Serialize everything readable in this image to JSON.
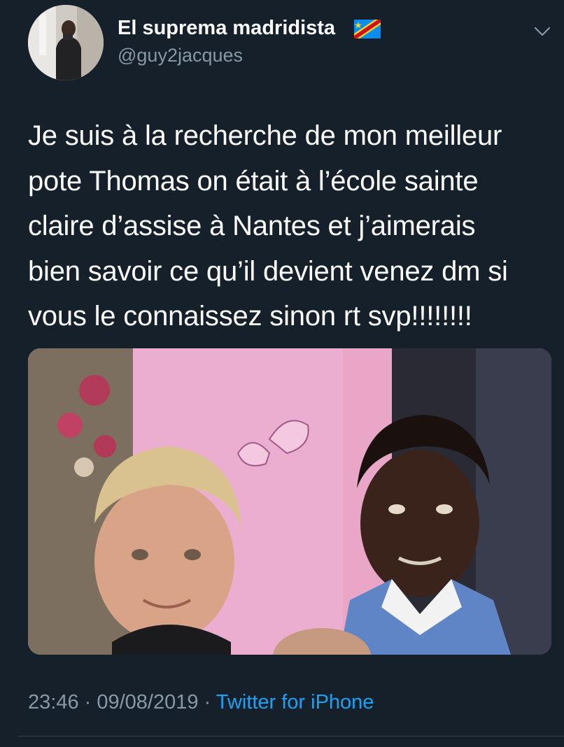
{
  "user": {
    "display_name": "El suprema madridista",
    "flag_icon": "flag-icon",
    "handle": "@guy2jacques"
  },
  "tweet": {
    "text": "Je suis à la recherche de mon meilleur\npote Thomas on était à l’école sainte\nclaire d’assise à Nantes et j’aimerais\nbien savoir ce qu’il devient venez dm si\nvous le connaissez sinon rt svp!!!!!!!!",
    "time": "23:46",
    "separator": " · ",
    "date": "09/08/2019",
    "source": "Twitter for iPhone"
  },
  "colors": {
    "background": "#15202b",
    "text": "#ffffff",
    "secondary": "#8899a6",
    "link": "#1da1f2",
    "divider": "#38444d"
  }
}
